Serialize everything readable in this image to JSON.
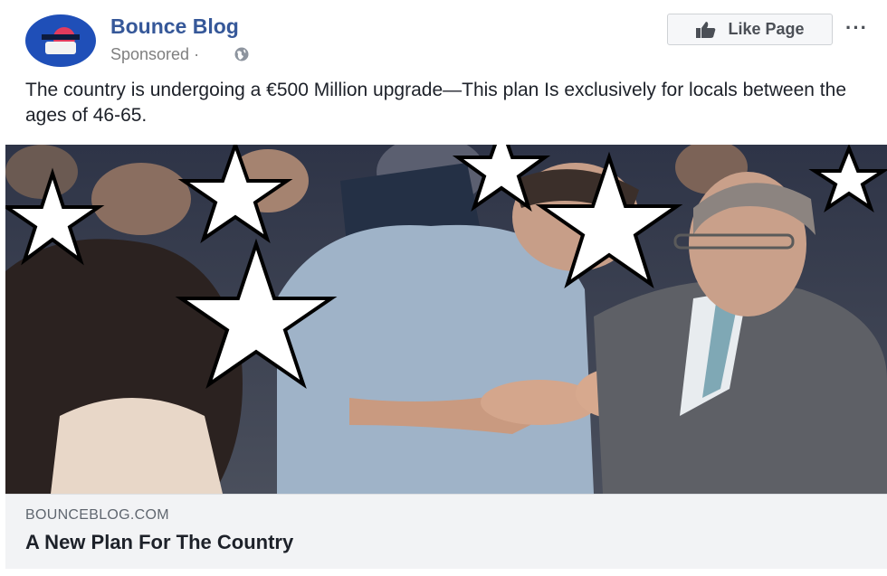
{
  "post": {
    "page_name": "Bounce Blog",
    "sponsored_label": "Sponsored · ",
    "like_button_label": "Like Page",
    "more_label": "···",
    "body_text": "The country is undergoing a €500 Million upgrade—This plan Is exclusively for locals between the ages of 46-65."
  },
  "link": {
    "domain": "BOUNCEBLOG.COM",
    "title": "A New Plan For The Country"
  },
  "icons": {
    "globe": "globe-icon",
    "like": "thumbs-up-icon",
    "more": "more-options-icon"
  },
  "colors": {
    "page_name": "#365899",
    "link_background": "#f2f3f5"
  }
}
